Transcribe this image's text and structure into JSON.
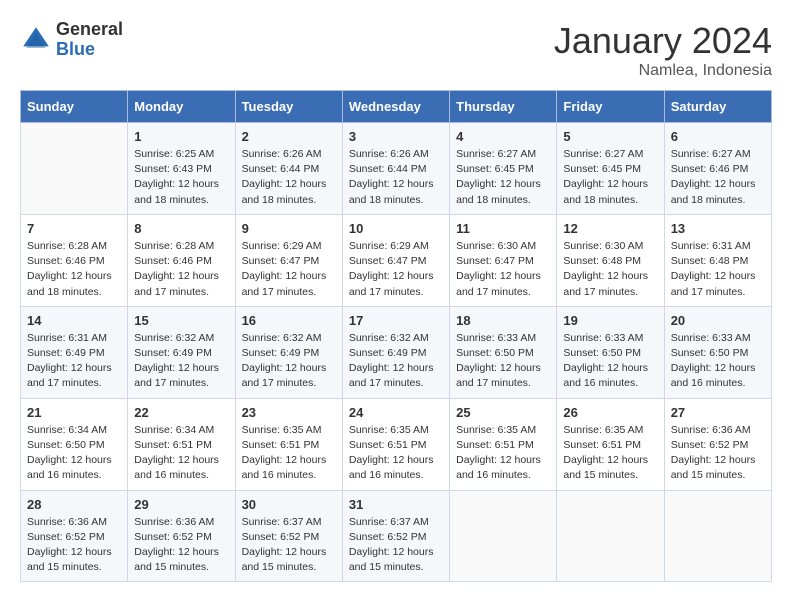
{
  "logo": {
    "general": "General",
    "blue": "Blue"
  },
  "header": {
    "month": "January 2024",
    "location": "Namlea, Indonesia"
  },
  "days_of_week": [
    "Sunday",
    "Monday",
    "Tuesday",
    "Wednesday",
    "Thursday",
    "Friday",
    "Saturday"
  ],
  "weeks": [
    [
      {
        "day": "",
        "info": ""
      },
      {
        "day": "1",
        "info": "Sunrise: 6:25 AM\nSunset: 6:43 PM\nDaylight: 12 hours\nand 18 minutes."
      },
      {
        "day": "2",
        "info": "Sunrise: 6:26 AM\nSunset: 6:44 PM\nDaylight: 12 hours\nand 18 minutes."
      },
      {
        "day": "3",
        "info": "Sunrise: 6:26 AM\nSunset: 6:44 PM\nDaylight: 12 hours\nand 18 minutes."
      },
      {
        "day": "4",
        "info": "Sunrise: 6:27 AM\nSunset: 6:45 PM\nDaylight: 12 hours\nand 18 minutes."
      },
      {
        "day": "5",
        "info": "Sunrise: 6:27 AM\nSunset: 6:45 PM\nDaylight: 12 hours\nand 18 minutes."
      },
      {
        "day": "6",
        "info": "Sunrise: 6:27 AM\nSunset: 6:46 PM\nDaylight: 12 hours\nand 18 minutes."
      }
    ],
    [
      {
        "day": "7",
        "info": "Sunrise: 6:28 AM\nSunset: 6:46 PM\nDaylight: 12 hours\nand 18 minutes."
      },
      {
        "day": "8",
        "info": "Sunrise: 6:28 AM\nSunset: 6:46 PM\nDaylight: 12 hours\nand 17 minutes."
      },
      {
        "day": "9",
        "info": "Sunrise: 6:29 AM\nSunset: 6:47 PM\nDaylight: 12 hours\nand 17 minutes."
      },
      {
        "day": "10",
        "info": "Sunrise: 6:29 AM\nSunset: 6:47 PM\nDaylight: 12 hours\nand 17 minutes."
      },
      {
        "day": "11",
        "info": "Sunrise: 6:30 AM\nSunset: 6:47 PM\nDaylight: 12 hours\nand 17 minutes."
      },
      {
        "day": "12",
        "info": "Sunrise: 6:30 AM\nSunset: 6:48 PM\nDaylight: 12 hours\nand 17 minutes."
      },
      {
        "day": "13",
        "info": "Sunrise: 6:31 AM\nSunset: 6:48 PM\nDaylight: 12 hours\nand 17 minutes."
      }
    ],
    [
      {
        "day": "14",
        "info": "Sunrise: 6:31 AM\nSunset: 6:49 PM\nDaylight: 12 hours\nand 17 minutes."
      },
      {
        "day": "15",
        "info": "Sunrise: 6:32 AM\nSunset: 6:49 PM\nDaylight: 12 hours\nand 17 minutes."
      },
      {
        "day": "16",
        "info": "Sunrise: 6:32 AM\nSunset: 6:49 PM\nDaylight: 12 hours\nand 17 minutes."
      },
      {
        "day": "17",
        "info": "Sunrise: 6:32 AM\nSunset: 6:49 PM\nDaylight: 12 hours\nand 17 minutes."
      },
      {
        "day": "18",
        "info": "Sunrise: 6:33 AM\nSunset: 6:50 PM\nDaylight: 12 hours\nand 17 minutes."
      },
      {
        "day": "19",
        "info": "Sunrise: 6:33 AM\nSunset: 6:50 PM\nDaylight: 12 hours\nand 16 minutes."
      },
      {
        "day": "20",
        "info": "Sunrise: 6:33 AM\nSunset: 6:50 PM\nDaylight: 12 hours\nand 16 minutes."
      }
    ],
    [
      {
        "day": "21",
        "info": "Sunrise: 6:34 AM\nSunset: 6:50 PM\nDaylight: 12 hours\nand 16 minutes."
      },
      {
        "day": "22",
        "info": "Sunrise: 6:34 AM\nSunset: 6:51 PM\nDaylight: 12 hours\nand 16 minutes."
      },
      {
        "day": "23",
        "info": "Sunrise: 6:35 AM\nSunset: 6:51 PM\nDaylight: 12 hours\nand 16 minutes."
      },
      {
        "day": "24",
        "info": "Sunrise: 6:35 AM\nSunset: 6:51 PM\nDaylight: 12 hours\nand 16 minutes."
      },
      {
        "day": "25",
        "info": "Sunrise: 6:35 AM\nSunset: 6:51 PM\nDaylight: 12 hours\nand 16 minutes."
      },
      {
        "day": "26",
        "info": "Sunrise: 6:35 AM\nSunset: 6:51 PM\nDaylight: 12 hours\nand 15 minutes."
      },
      {
        "day": "27",
        "info": "Sunrise: 6:36 AM\nSunset: 6:52 PM\nDaylight: 12 hours\nand 15 minutes."
      }
    ],
    [
      {
        "day": "28",
        "info": "Sunrise: 6:36 AM\nSunset: 6:52 PM\nDaylight: 12 hours\nand 15 minutes."
      },
      {
        "day": "29",
        "info": "Sunrise: 6:36 AM\nSunset: 6:52 PM\nDaylight: 12 hours\nand 15 minutes."
      },
      {
        "day": "30",
        "info": "Sunrise: 6:37 AM\nSunset: 6:52 PM\nDaylight: 12 hours\nand 15 minutes."
      },
      {
        "day": "31",
        "info": "Sunrise: 6:37 AM\nSunset: 6:52 PM\nDaylight: 12 hours\nand 15 minutes."
      },
      {
        "day": "",
        "info": ""
      },
      {
        "day": "",
        "info": ""
      },
      {
        "day": "",
        "info": ""
      }
    ]
  ]
}
